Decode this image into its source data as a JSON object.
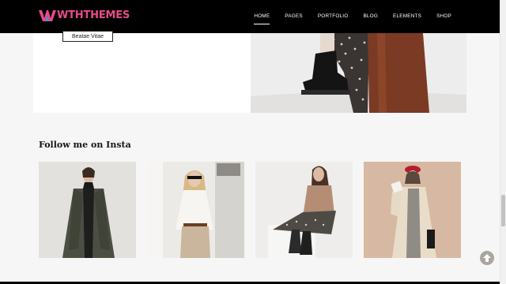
{
  "header": {
    "logo_text": "WTHTHEMES",
    "nav": [
      {
        "label": "HOME",
        "active": true
      },
      {
        "label": "PAGES",
        "active": false
      },
      {
        "label": "PORTFOLIO",
        "active": false
      },
      {
        "label": "BLOG",
        "active": false
      },
      {
        "label": "ELEMENTS",
        "active": false
      },
      {
        "label": "SHOP",
        "active": false
      }
    ]
  },
  "upper": {
    "button_label": "Beatae Vitae"
  },
  "insta": {
    "title": "Follow me on Insta",
    "tiles": [
      {
        "icon": "model-dark-coat-photo"
      },
      {
        "icon": "model-blonde-sunglasses-photo"
      },
      {
        "icon": "model-knit-cardigan-photo"
      },
      {
        "icon": "model-beret-trench-photo"
      }
    ]
  },
  "icons": {
    "scroll_top": "arrow-up-circle-icon"
  },
  "colors": {
    "header_bg": "#000000",
    "logo_pink": "#e94a8c",
    "logo_blue": "#3aa0d8",
    "page_bg": "#f7f6f6"
  }
}
